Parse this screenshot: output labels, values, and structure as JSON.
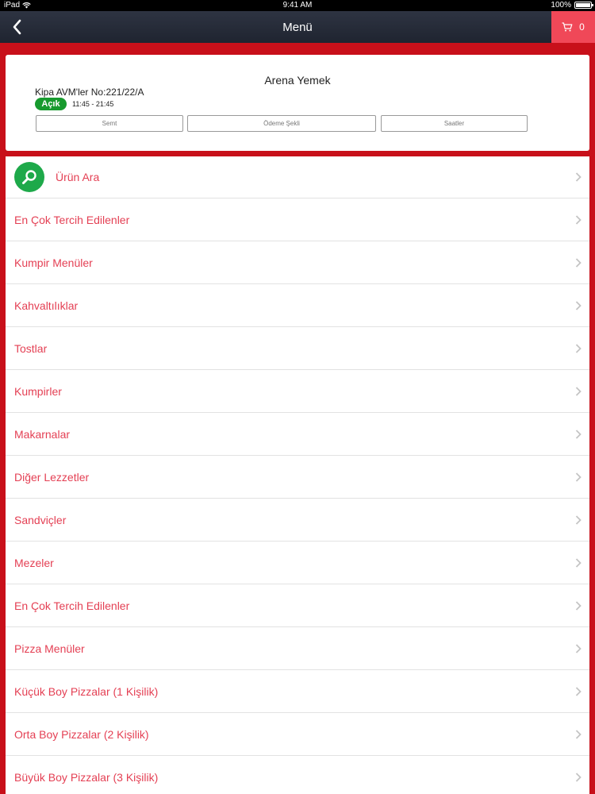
{
  "status_bar": {
    "device": "iPad",
    "time": "9:41 AM",
    "battery": "100%"
  },
  "nav": {
    "title": "Menü",
    "cart_count": "0"
  },
  "restaurant": {
    "name": "Arena Yemek",
    "address": "Kipa AVM'ler No:221/22/A",
    "status": "Açık",
    "hours": "11:45 - 21:45",
    "buttons": {
      "district": "Semt",
      "payment": "Ödeme Şekli",
      "hours": "Saatler"
    }
  },
  "colors": {
    "accent": "#e44054",
    "nav": "#262b37",
    "background": "#c8101a",
    "open": "#179a2e",
    "search": "#1ea94a"
  },
  "menu": {
    "search_label": "Ürün Ara",
    "items": [
      "En Çok Tercih Edilenler",
      "Kumpir Menüler",
      "Kahvaltılıklar",
      "Tostlar",
      "Kumpirler",
      "Makarnalar",
      "Diğer Lezzetler",
      "Sandviçler",
      "Mezeler",
      "En Çok Tercih Edilenler",
      "Pizza Menüler",
      "Küçük Boy Pizzalar (1 Kişilik)",
      "Orta Boy Pizzalar (2 Kişilik)",
      "Büyük Boy Pizzalar (3 Kişilik)"
    ]
  }
}
